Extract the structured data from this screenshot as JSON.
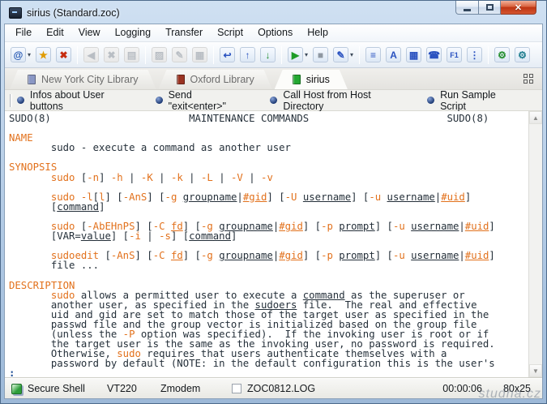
{
  "window": {
    "title": "sirius (Standard.zoc)"
  },
  "menu": {
    "items": [
      {
        "id": "file",
        "label": "File"
      },
      {
        "id": "edit",
        "label": "Edit"
      },
      {
        "id": "view",
        "label": "View"
      },
      {
        "id": "logging",
        "label": "Logging"
      },
      {
        "id": "transfer",
        "label": "Transfer"
      },
      {
        "id": "script",
        "label": "Script"
      },
      {
        "id": "options",
        "label": "Options"
      },
      {
        "id": "help",
        "label": "Help"
      }
    ]
  },
  "toolbar": {
    "items": [
      {
        "id": "connection-directory",
        "glyph": "@",
        "color": "#1a50b0",
        "caret": true
      },
      {
        "id": "quick-connection",
        "glyph": "★",
        "color": "#e09b00"
      },
      {
        "id": "disconnect",
        "glyph": "✖",
        "color": "#c62d10"
      },
      {
        "sep": true
      },
      {
        "id": "previous-session",
        "glyph": "◀",
        "color": "#b5bac0",
        "disabled": true
      },
      {
        "id": "close-session",
        "glyph": "✖",
        "color": "#b5bac0",
        "disabled": true
      },
      {
        "id": "session-log",
        "glyph": "▤",
        "color": "#b5bac0",
        "disabled": true
      },
      {
        "sep": true
      },
      {
        "id": "paste",
        "glyph": "▨",
        "color": "#b5bac0",
        "disabled": true
      },
      {
        "id": "clipboard-edit",
        "glyph": "✎",
        "color": "#b5bac0",
        "disabled": true
      },
      {
        "id": "print",
        "glyph": "▦",
        "color": "#b5bac0",
        "disabled": true
      },
      {
        "sep": true
      },
      {
        "id": "send-text",
        "glyph": "↩",
        "color": "#2a52c0"
      },
      {
        "id": "upload-file",
        "glyph": "↑",
        "color": "#2a52c0"
      },
      {
        "id": "download-file",
        "glyph": "↓",
        "color": "#1e8c28"
      },
      {
        "sep": true
      },
      {
        "id": "run-script",
        "glyph": "▶",
        "color": "#1e9c28",
        "caret": true
      },
      {
        "id": "stop-script",
        "glyph": "■",
        "color": "#8f98a2"
      },
      {
        "id": "edit-script",
        "glyph": "✎",
        "color": "#2a52c0",
        "caret": true
      },
      {
        "sep": true
      },
      {
        "id": "emulation-options",
        "glyph": "≡",
        "color": "#2a52c0"
      },
      {
        "id": "font-options",
        "glyph": "A",
        "color": "#2a52c0"
      },
      {
        "id": "color-options",
        "glyph": "▦",
        "color": "#2a52c0"
      },
      {
        "id": "modem-options",
        "glyph": "☎",
        "color": "#2a52c0"
      },
      {
        "id": "function-key-options",
        "glyph": "F1",
        "color": "#2a52c0",
        "small": true
      },
      {
        "id": "misc-options",
        "glyph": "⋮",
        "color": "#2a52c0"
      },
      {
        "sep": true
      },
      {
        "id": "device-tools",
        "glyph": "⚙",
        "color": "#1e8c28"
      },
      {
        "id": "session-settings",
        "glyph": "⚙",
        "color": "#1a7a8c"
      }
    ]
  },
  "tabs": {
    "items": [
      {
        "id": "new-york-city-library",
        "label": "New York City Library",
        "icon_color": "#8a97c4",
        "active": false
      },
      {
        "id": "oxford-library",
        "label": "Oxford Library",
        "icon_color": "#9a3322",
        "active": false
      },
      {
        "id": "sirius",
        "label": "sirius",
        "icon_color": "#24a832",
        "active": true
      }
    ]
  },
  "button_bar": {
    "items": [
      {
        "id": "infos-about-user-buttons",
        "label": "Infos about User buttons"
      },
      {
        "id": "send-exit-enter",
        "label": "Send \"exit<enter>\""
      },
      {
        "id": "call-host-from-host-directory",
        "label": "Call Host from Host Directory"
      },
      {
        "id": "run-sample-script",
        "label": "Run Sample Script"
      }
    ]
  },
  "terminal": {
    "lines": [
      [
        [
          "k",
          "SUDO(8)                       MAINTENANCE COMMANDS                       SUDO(8)"
        ]
      ],
      [],
      [
        [
          "o",
          "NAME"
        ]
      ],
      [
        [
          "k",
          "       sudo - execute a command as another user"
        ]
      ],
      [],
      [
        [
          "o",
          "SYNOPSIS"
        ]
      ],
      [
        [
          "k",
          "       "
        ],
        [
          "o",
          "sudo"
        ],
        [
          "k",
          " ["
        ],
        [
          "o",
          "-n"
        ],
        [
          "k",
          "] "
        ],
        [
          "o",
          "-h"
        ],
        [
          "k",
          " | "
        ],
        [
          "o",
          "-K"
        ],
        [
          "k",
          " | "
        ],
        [
          "o",
          "-k"
        ],
        [
          "k",
          " | "
        ],
        [
          "o",
          "-L"
        ],
        [
          "k",
          " | "
        ],
        [
          "o",
          "-V"
        ],
        [
          "k",
          " | "
        ],
        [
          "o",
          "-v"
        ]
      ],
      [],
      [
        [
          "k",
          "       "
        ],
        [
          "o",
          "sudo"
        ],
        [
          "k",
          " "
        ],
        [
          "o",
          "-l"
        ],
        [
          "k",
          "["
        ],
        [
          "o",
          "l"
        ],
        [
          "k",
          "] ["
        ],
        [
          "o",
          "-AnS"
        ],
        [
          "k",
          "] ["
        ],
        [
          "o",
          "-g"
        ],
        [
          "k",
          " "
        ],
        [
          "nu",
          "groupname"
        ],
        [
          "k",
          "|"
        ],
        [
          "ou",
          "#gid"
        ],
        [
          "k",
          "] ["
        ],
        [
          "o",
          "-U"
        ],
        [
          "k",
          " "
        ],
        [
          "nu",
          "username"
        ],
        [
          "k",
          "] ["
        ],
        [
          "o",
          "-u"
        ],
        [
          "k",
          " "
        ],
        [
          "nu",
          "username"
        ],
        [
          "k",
          "|"
        ],
        [
          "ou",
          "#uid"
        ],
        [
          "k",
          "]"
        ]
      ],
      [
        [
          "k",
          "       ["
        ],
        [
          "nu",
          "command"
        ],
        [
          "k",
          "]"
        ]
      ],
      [],
      [
        [
          "k",
          "       "
        ],
        [
          "o",
          "sudo"
        ],
        [
          "k",
          " ["
        ],
        [
          "o",
          "-AbEHnPS"
        ],
        [
          "k",
          "] ["
        ],
        [
          "o",
          "-C"
        ],
        [
          "k",
          " "
        ],
        [
          "ou",
          "fd"
        ],
        [
          "k",
          "] ["
        ],
        [
          "o",
          "-g"
        ],
        [
          "k",
          " "
        ],
        [
          "nu",
          "groupname"
        ],
        [
          "k",
          "|"
        ],
        [
          "ou",
          "#gid"
        ],
        [
          "k",
          "] ["
        ],
        [
          "o",
          "-p"
        ],
        [
          "k",
          " "
        ],
        [
          "nu",
          "prompt"
        ],
        [
          "k",
          "] ["
        ],
        [
          "o",
          "-u"
        ],
        [
          "k",
          " "
        ],
        [
          "nu",
          "username"
        ],
        [
          "k",
          "|"
        ],
        [
          "ou",
          "#uid"
        ],
        [
          "k",
          "]"
        ]
      ],
      [
        [
          "k",
          "       [VAR="
        ],
        [
          "nu",
          "value"
        ],
        [
          "k",
          "] ["
        ],
        [
          "o",
          "-i"
        ],
        [
          "k",
          " | "
        ],
        [
          "o",
          "-s"
        ],
        [
          "k",
          "] ["
        ],
        [
          "nu",
          "command"
        ],
        [
          "k",
          "]"
        ]
      ],
      [],
      [
        [
          "k",
          "       "
        ],
        [
          "o",
          "sudoedit"
        ],
        [
          "k",
          " ["
        ],
        [
          "o",
          "-AnS"
        ],
        [
          "k",
          "] ["
        ],
        [
          "o",
          "-C"
        ],
        [
          "k",
          " "
        ],
        [
          "ou",
          "fd"
        ],
        [
          "k",
          "] ["
        ],
        [
          "o",
          "-g"
        ],
        [
          "k",
          " "
        ],
        [
          "nu",
          "groupname"
        ],
        [
          "k",
          "|"
        ],
        [
          "ou",
          "#gid"
        ],
        [
          "k",
          "] ["
        ],
        [
          "o",
          "-p"
        ],
        [
          "k",
          " "
        ],
        [
          "nu",
          "prompt"
        ],
        [
          "k",
          "] ["
        ],
        [
          "o",
          "-u"
        ],
        [
          "k",
          " "
        ],
        [
          "nu",
          "username"
        ],
        [
          "k",
          "|"
        ],
        [
          "ou",
          "#uid"
        ],
        [
          "k",
          "]"
        ]
      ],
      [
        [
          "k",
          "       file ..."
        ]
      ],
      [],
      [
        [
          "o",
          "DESCRIPTION"
        ]
      ],
      [
        [
          "k",
          "       "
        ],
        [
          "o",
          "sudo"
        ],
        [
          "k",
          " allows a permitted user to execute a "
        ],
        [
          "nu",
          "command"
        ],
        [
          "k",
          " as the superuser or"
        ]
      ],
      [
        [
          "k",
          "       another user, as specified in the "
        ],
        [
          "nu",
          "sudoers"
        ],
        [
          "k",
          " file.  The real and effective"
        ]
      ],
      [
        [
          "k",
          "       uid and gid are set to match those of the target user as specified in the"
        ]
      ],
      [
        [
          "k",
          "       passwd file and the group vector is initialized based on the group file"
        ]
      ],
      [
        [
          "k",
          "       (unless the "
        ],
        [
          "o",
          "-P"
        ],
        [
          "k",
          " option was specified).  If the invoking user is root or if"
        ]
      ],
      [
        [
          "k",
          "       the target user is the same as the invoking user, no password is required."
        ]
      ],
      [
        [
          "k",
          "       Otherwise, "
        ],
        [
          "o",
          "sudo"
        ],
        [
          "k",
          " requires that users authenticate themselves with a"
        ]
      ],
      [
        [
          "k",
          "       password by default (NOTE: in the default configuration this is the user's"
        ]
      ],
      [
        [
          "p",
          ":"
        ]
      ]
    ]
  },
  "status_bar": {
    "connection": "Secure Shell",
    "emulation": "VT220",
    "transfer": "Zmodem",
    "log_file": "ZOC0812.LOG",
    "time": "00:00:06",
    "size": "80x25"
  },
  "watermark": "studna.cz",
  "colors": {
    "terminal_text": "#25303a",
    "terminal_orange": "#e2711c",
    "terminal_prompt": "#1f4f96"
  }
}
